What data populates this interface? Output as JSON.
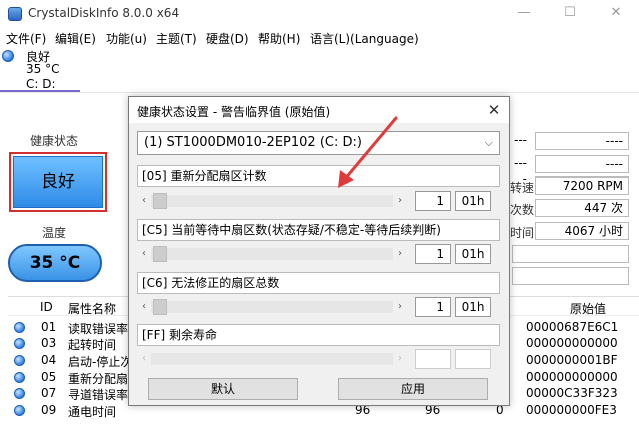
{
  "window": {
    "title": "CrystalDiskInfo 8.0.0 x64",
    "min_glyph": "—",
    "max_glyph": "☐",
    "close_glyph": "✕"
  },
  "menu": [
    "文件(F)",
    "编辑(E)",
    "功能(u)",
    "主题(T)",
    "硬盘(D)",
    "帮助(H)",
    "语言(L)(Language)"
  ],
  "drive_tab": {
    "health": "良好",
    "temp": "35 °C",
    "drive": "C: D:"
  },
  "main": {
    "health_label": "健康状态",
    "health_value": "良好",
    "temp_label": "温度",
    "temp_value": "35 °C",
    "right_info": [
      {
        "label": "",
        "value": "----"
      },
      {
        "label": "",
        "value": "----"
      },
      {
        "label": "",
        "value": "----"
      },
      {
        "label": "转速",
        "value": "7200 RPM"
      },
      {
        "label": "次数",
        "value": "447 次"
      },
      {
        "label": "时间",
        "value": "4067 小时"
      }
    ]
  },
  "attr_table": {
    "headers": {
      "id": "ID",
      "name": "属性名称",
      "raw": "原始值"
    },
    "rows": [
      {
        "id": "01",
        "name": "读取错误率",
        "raw": "00000687E6C1"
      },
      {
        "id": "03",
        "name": "起转时间",
        "raw": "000000000000"
      },
      {
        "id": "04",
        "name": "启动-停止次",
        "raw": "0000000001BF"
      },
      {
        "id": "05",
        "name": "重新分配扇区",
        "raw": "000000000000"
      },
      {
        "id": "07",
        "name": "寻道错误率",
        "raw": "00000C33F323"
      },
      {
        "id": "09",
        "name": "通电时间",
        "c1": "96",
        "c2": "96",
        "c3": "0",
        "raw": "000000000FE3"
      }
    ]
  },
  "dialog": {
    "title": "健康状态设置 - 警告临界值 (原始值)",
    "close_glyph": "✕",
    "drive_select": "(1) ST1000DM010-2EP102 (C: D:)",
    "sections": [
      {
        "label": "[05] 重新分配扇区计数",
        "value": "1",
        "hex": "01h",
        "enabled": true
      },
      {
        "label": "[C5] 当前等待中扇区数(状态存疑/不稳定-等待后续判断)",
        "value": "1",
        "hex": "01h",
        "enabled": true
      },
      {
        "label": "[C6] 无法修正的扇区总数",
        "value": "1",
        "hex": "01h",
        "enabled": true
      },
      {
        "label": "[FF] 剩余寿命",
        "value": "",
        "hex": "",
        "enabled": false
      }
    ],
    "default_button": "默认",
    "apply_button": "应用"
  },
  "colors": {
    "annotation_arrow": "#e03a3a",
    "health_blue": "#2f8be8",
    "highlight_box": "#d03030"
  }
}
